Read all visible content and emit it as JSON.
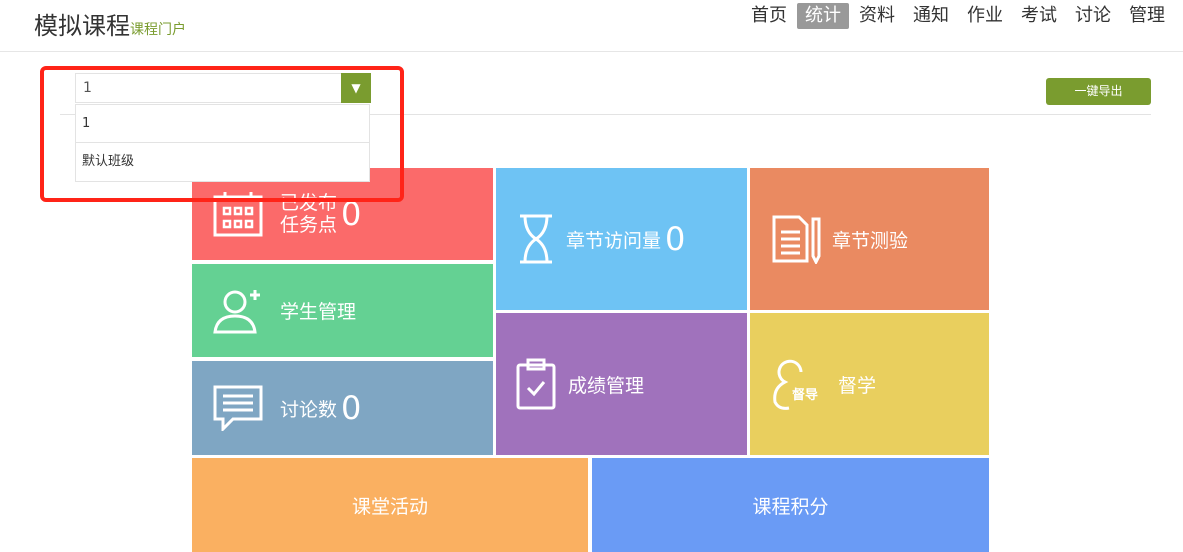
{
  "header": {
    "title": "模拟课程",
    "subtitle": "课程门户",
    "nav": [
      "首页",
      "统计",
      "资料",
      "通知",
      "作业",
      "考试",
      "讨论",
      "管理"
    ],
    "active": "统计"
  },
  "class_select": {
    "value": "1",
    "options": [
      "1",
      "默认班级"
    ]
  },
  "export_label": "一键导出",
  "tiles": {
    "tasks": {
      "label1": "已发布",
      "label2": "任务点",
      "count": "0"
    },
    "visits": {
      "label": "章节访问量",
      "count": "0"
    },
    "quiz": {
      "label": "章节测验"
    },
    "students": {
      "label": "学生管理"
    },
    "grades": {
      "label": "成绩管理"
    },
    "supervise": {
      "label": "督学",
      "icon_text": "督导"
    },
    "discuss": {
      "label": "讨论数",
      "count": "0"
    },
    "activity": {
      "label": "课堂活动"
    },
    "points": {
      "label": "课程积分"
    }
  }
}
